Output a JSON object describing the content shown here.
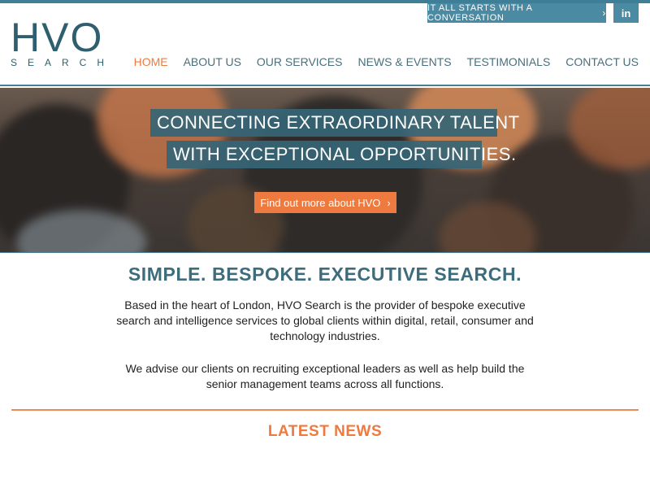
{
  "header": {
    "cta_label": "IT ALL STARTS WITH A CONVERSATION",
    "linkedin_label": "in",
    "logo": {
      "main": "HVO",
      "sub": "SEARCH"
    }
  },
  "nav": {
    "items": [
      {
        "label": "HOME",
        "active": true
      },
      {
        "label": "ABOUT US"
      },
      {
        "label": "OUR SERVICES"
      },
      {
        "label": "NEWS & EVENTS"
      },
      {
        "label": "TESTIMONIALS"
      },
      {
        "label": "CONTACT US"
      }
    ]
  },
  "hero": {
    "line1": "CONNECTING EXTRAORDINARY TALENT",
    "line2": "WITH EXCEPTIONAL OPPORTUNITIES.",
    "button_label": "Find out more about HVO"
  },
  "intro": {
    "tagline": "SIMPLE. BESPOKE. EXECUTIVE SEARCH.",
    "paragraph1": "Based in the heart of London, HVO Search is the provider of bespoke executive search and intelligence services to global clients within digital, retail, consumer and technology industries.",
    "paragraph2": "We advise our clients on recruiting exceptional leaders as well as help build the senior management teams across all functions."
  },
  "latest_news": {
    "heading": "LATEST NEWS"
  },
  "colors": {
    "accent_orange": "#ee7a3f",
    "brand_teal": "#3e7f97",
    "logo_teal": "#2f5f6f"
  }
}
